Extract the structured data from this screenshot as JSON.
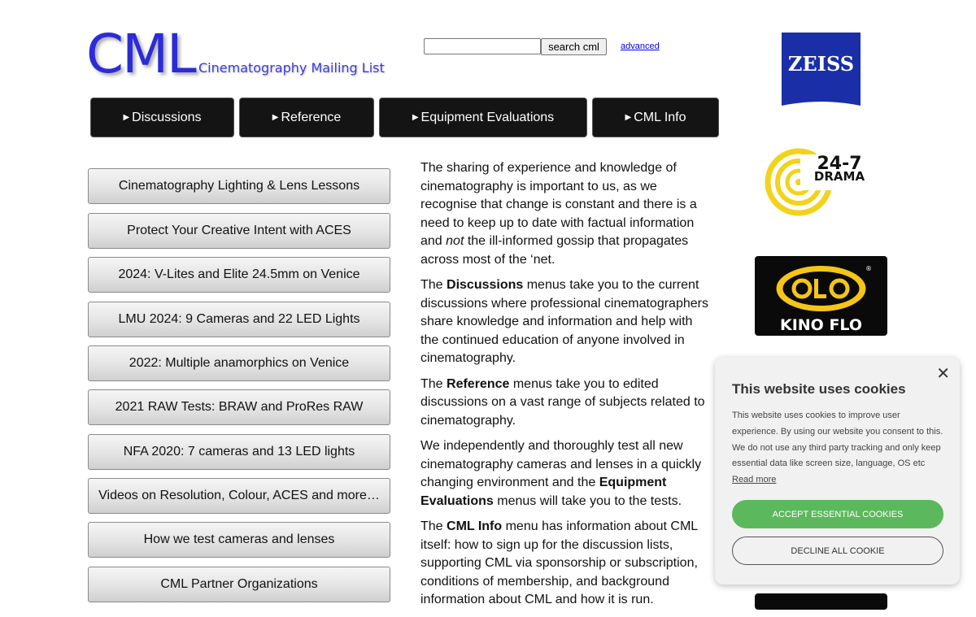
{
  "logo": {
    "main": "CML",
    "sub": "Cinematography Mailing List"
  },
  "search": {
    "button_label": "search cml",
    "advanced_label": "advanced",
    "value": ""
  },
  "topnav": [
    {
      "label": "Discussions"
    },
    {
      "label": "Reference"
    },
    {
      "label": "Equipment Evaluations"
    },
    {
      "label": "CML Info"
    }
  ],
  "topnav_arrow": "▶",
  "left_links": [
    {
      "label": "Cinematography Lighting & Lens Lessons"
    },
    {
      "label": "Protect Your Creative Intent with ACES"
    },
    {
      "label": "2024: V-Lites and Elite 24.5mm on Venice"
    },
    {
      "label": "LMU 2024: 9 Cameras and 22 LED Lights"
    },
    {
      "label": "2022: Multiple anamorphics on Venice"
    },
    {
      "label": "2021 RAW Tests: BRAW and ProRes RAW"
    },
    {
      "label": "NFA 2020: 7 cameras and 13 LED lights"
    },
    {
      "label": "Videos on Resolution, Colour, ACES and more…"
    },
    {
      "label": "How we test cameras and lenses"
    },
    {
      "label": "CML Partner Organizations"
    }
  ],
  "main": {
    "p1_a": "The sharing of experience and knowledge of cinematography is important to us, as we recognise that change is constant and there is a need to keep up to date with factual information and ",
    "p1_em": "not",
    "p1_b": " the ill-informed gossip that propagates across most of the ‘net.",
    "p2_a": "The ",
    "p2_b": "Discussions",
    "p2_c": " menus take you to the current discussions where professional cinematographers share knowledge and information and help with the continued education of anyone involved in cinematography.",
    "p3_a": "The ",
    "p3_b": "Reference",
    "p3_c": " menus take you to edited discussions on a vast range of subjects related to cinematography.",
    "p4_a": "We independently and thoroughly test all new cinematography cameras and lenses in a quickly changing environment and the ",
    "p4_b": "Equipment Evaluations",
    "p4_c": " menus will take you to the tests.",
    "p5_a": "The ",
    "p5_b": "CML Info",
    "p5_c": " menu has information about CML itself: how to sign up for the discussion lists, supporting CML via sponsorship or subscription, conditions of membership, and background information about CML and how it is run."
  },
  "sponsors": {
    "zeiss": "ZEISS",
    "drama_line1": "24-7",
    "drama_line2": "DRAMA",
    "kino": "KINO FLO",
    "kino_reg": "®"
  },
  "cookie": {
    "close": "✕",
    "title": "This website uses cookies",
    "body": "This website uses cookies to improve user experience. By using our website you consent to this. We do not use any third party tracking and only keep essential data like screen size, language, OS etc ",
    "read_more": "Read more",
    "accept": "ACCEPT ESSENTIAL COOKIES",
    "decline": "DECLINE ALL COOKIE"
  },
  "colors": {
    "logo_blue": "#2b2bd8",
    "zeiss_blue": "#1a2ea8",
    "drama_yellow": "#f2d31b",
    "kino_yellow": "#f5c518",
    "accept_green": "#5cb85c"
  }
}
